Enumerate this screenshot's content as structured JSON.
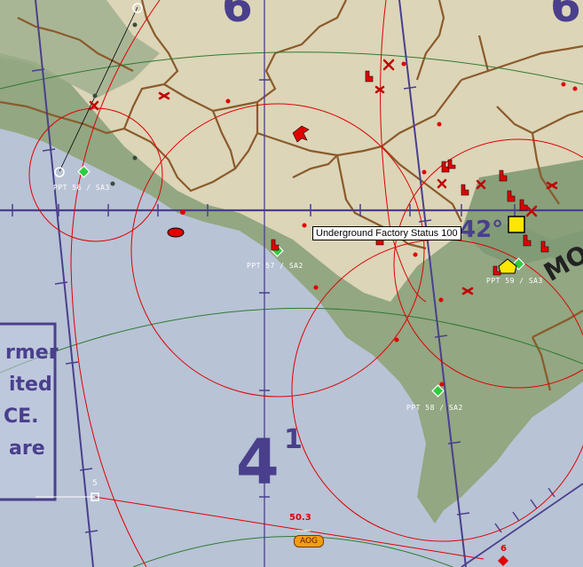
{
  "tooltip": {
    "text": "Underground Factory Status 100"
  },
  "sam_sites": [
    {
      "label": "PPT 56 / SA3"
    },
    {
      "label": "PPT 57 / SA2"
    },
    {
      "label": "PPT 59 / SA3"
    },
    {
      "label": "PPT 58 / SA2"
    }
  ],
  "chart_markings": {
    "grid_number": "4",
    "grid_number_sup": "1",
    "top_left_digit": "6",
    "top_right_digit": "6",
    "latitude": "42°",
    "region_text": "MO"
  },
  "info_panel": {
    "lines": [
      "rmer",
      "ited",
      "CE.",
      "are"
    ]
  },
  "flight_path": {
    "waypoint_number": "5",
    "distance_label": "50.3",
    "airbase_label": "AOG",
    "bottom_marker": "6"
  },
  "colors": {
    "water": "#b8c3d6",
    "land": "#dcd5b8",
    "forest": "#8aa27c",
    "border": "#8b5a2b",
    "threat_ring": "#e00000",
    "grid": "#4a3f8c"
  }
}
